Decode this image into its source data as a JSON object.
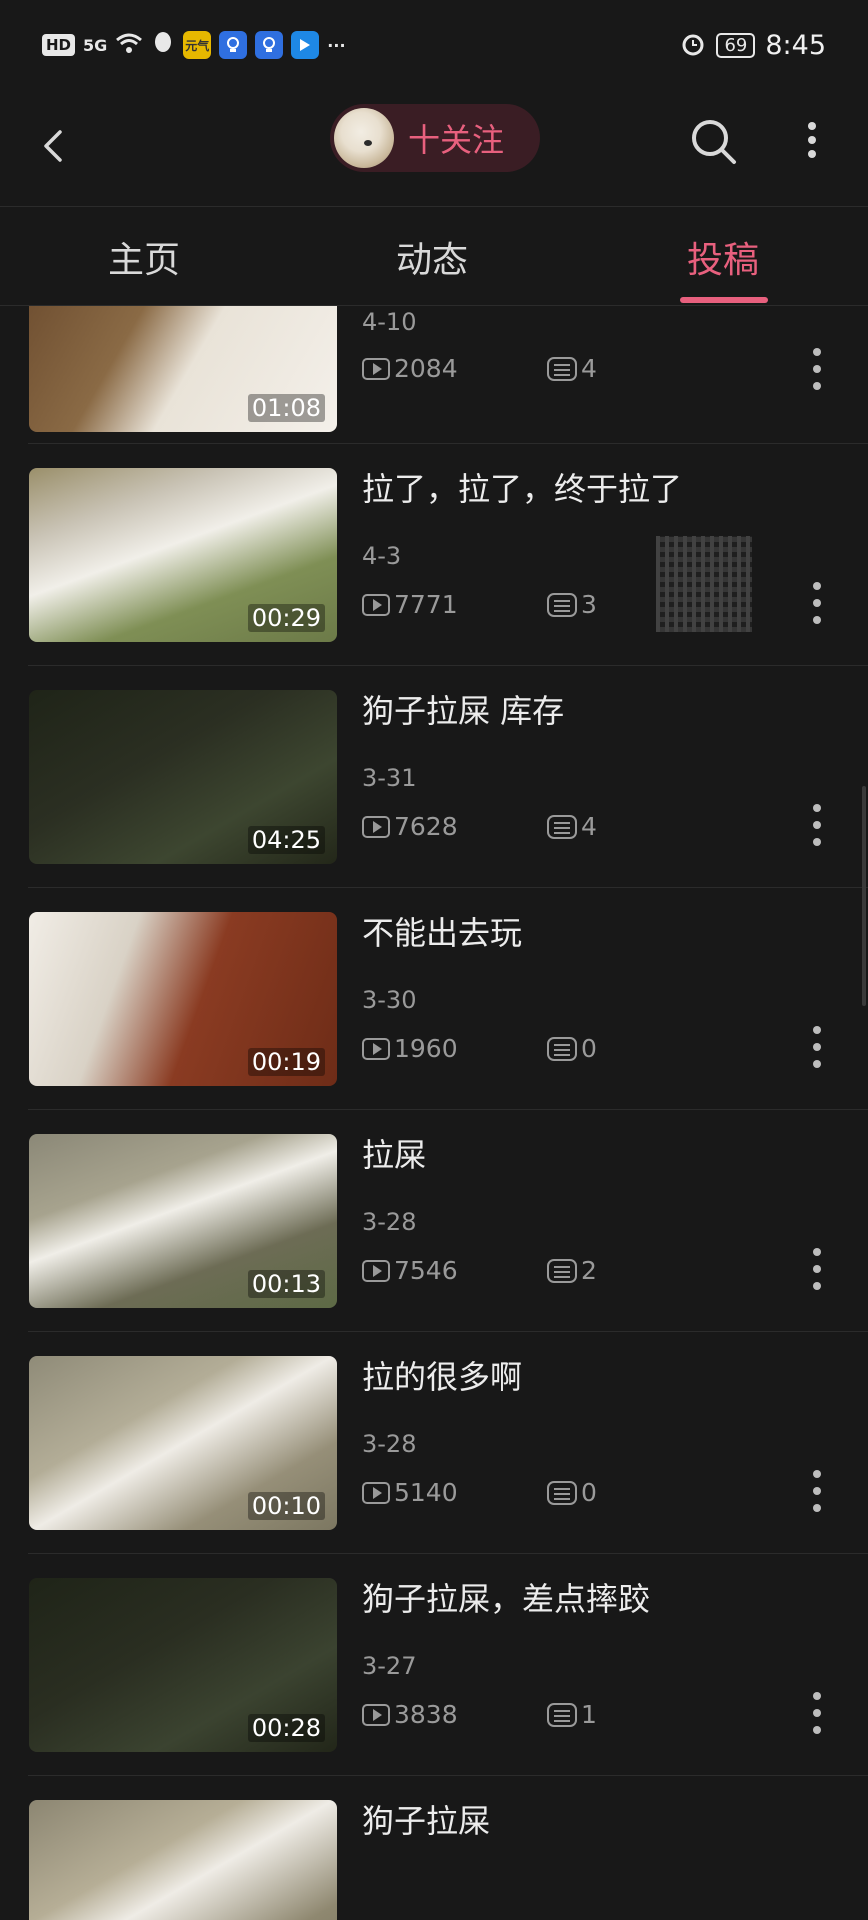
{
  "status_bar": {
    "left_badge": "HD",
    "signal": "5G",
    "apps": [
      "元气",
      "灯泡",
      "灯泡",
      "书签"
    ],
    "more": "···",
    "battery": "69",
    "time": "8:45"
  },
  "header": {
    "follow_label": "十关注"
  },
  "tabs": [
    "主页",
    "动态",
    "投稿"
  ],
  "active_tab": "投稿",
  "videos": [
    {
      "title": "...",
      "date": "4-10",
      "views": "2084",
      "comments": "4",
      "duration": "01:08"
    },
    {
      "title": "拉了，拉了，终于拉了",
      "date": "4-3",
      "views": "7771",
      "comments": "3",
      "duration": "00:29"
    },
    {
      "title": "狗子拉屎 库存",
      "date": "3-31",
      "views": "7628",
      "comments": "4",
      "duration": "04:25"
    },
    {
      "title": "不能出去玩",
      "date": "3-30",
      "views": "1960",
      "comments": "0",
      "duration": "00:19"
    },
    {
      "title": "拉屎",
      "date": "3-28",
      "views": "7546",
      "comments": "2",
      "duration": "00:13"
    },
    {
      "title": "拉的很多啊",
      "date": "3-28",
      "views": "5140",
      "comments": "0",
      "duration": "00:10"
    },
    {
      "title": "狗子拉屎，差点摔跤",
      "date": "3-27",
      "views": "3838",
      "comments": "1",
      "duration": "00:28"
    },
    {
      "title": "狗子拉屎",
      "date": "",
      "views": "",
      "comments": "",
      "duration": ""
    }
  ],
  "colors": {
    "accent": "#e8607e",
    "background": "#181818",
    "text": "#ececec",
    "muted": "#9a9a9a"
  }
}
